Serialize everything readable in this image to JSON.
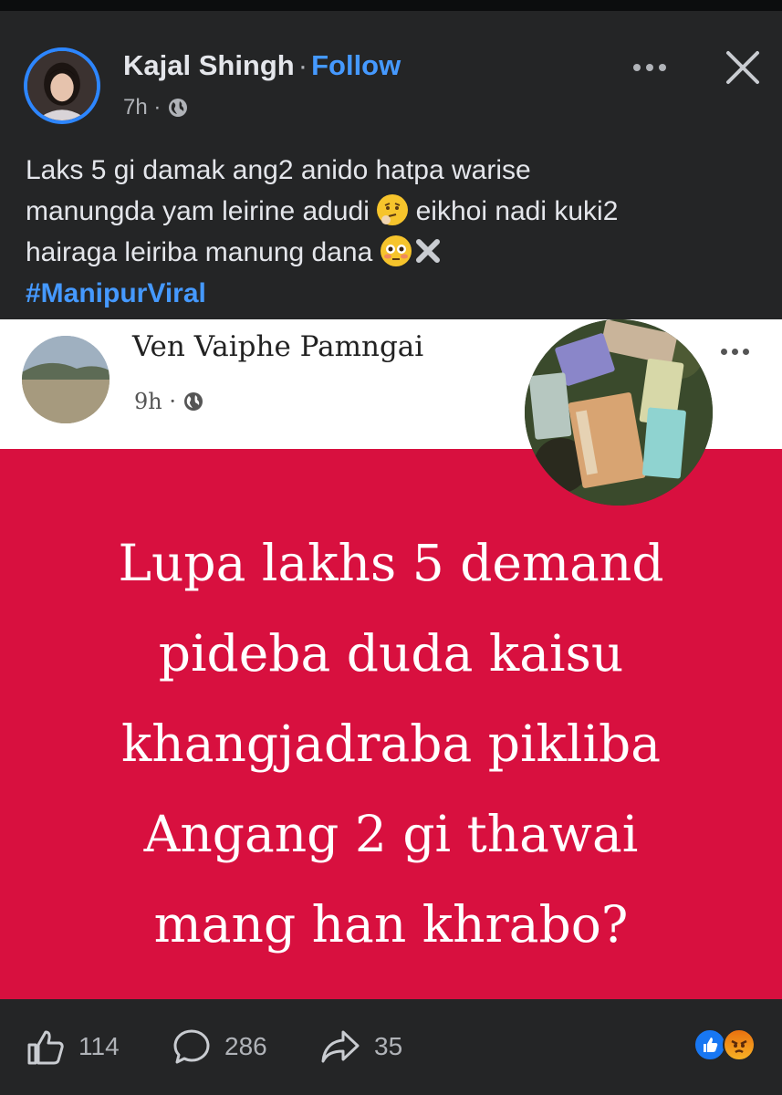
{
  "post": {
    "author": "Kajal Shingh",
    "separator": "·",
    "follow_label": "Follow",
    "time": "7h ·",
    "caption_lines": [
      "Laks 5 gi  damak ang2 anido hatpa warise",
      "manungda yam leirine adudi",
      "eikhoi nadi kuki2",
      "hairaga leiriba manung dana"
    ],
    "hashtag": "#ManipurViral"
  },
  "shared_post": {
    "author": "Ven Vaiphe Pamngai",
    "time": "9h ·",
    "text_lines": [
      "Lupa lakhs 5 demand",
      "pideba duda kaisu",
      "khangjadraba pikliba",
      "Angang 2 gi thawai",
      "mang han khrabo?"
    ]
  },
  "actions": {
    "likes": "114",
    "comments": "286",
    "shares": "35"
  },
  "icons": {
    "globe": "globe-icon",
    "more": "more-options-icon",
    "close": "close-icon",
    "like": "thumbs-up-icon",
    "comment": "comment-bubble-icon",
    "share": "share-arrow-icon",
    "reactions": [
      "like-reaction-icon",
      "angry-reaction-icon"
    ],
    "emojis": [
      "thinking-face-emoji",
      "flushed-face-emoji",
      "cross-mark-emoji"
    ]
  },
  "colors": {
    "background": "#242526",
    "accent": "#4599ff",
    "shared_card_red": "#d8103f",
    "like_blue": "#1877f2"
  }
}
